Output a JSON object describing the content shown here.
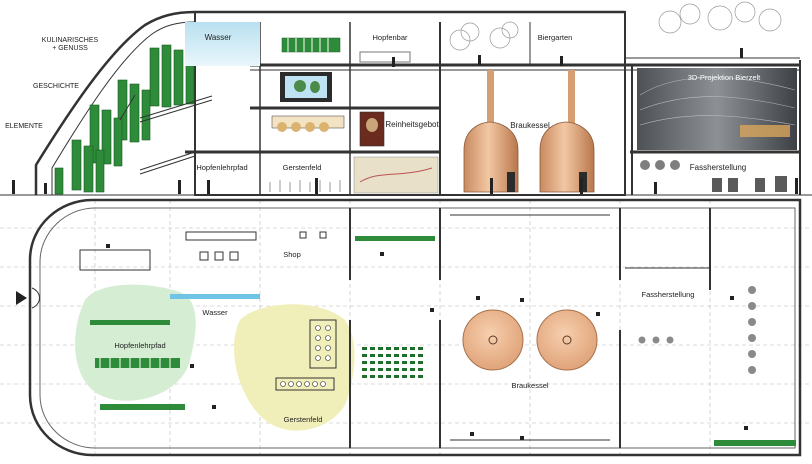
{
  "section": {
    "side_labels": {
      "culinary_line1": "KULINARISCHES",
      "culinary_line2": "+ GENUSS",
      "history": "GESCHICHTE",
      "elements": "ELEMENTE"
    },
    "rooms": {
      "water": "Wasser",
      "hop_bar": "Hopfenbar",
      "beer_garden": "Biergarten",
      "projection": "3D-Projektion Bierzelt",
      "purity_law": "Reinheitsgebot",
      "brew_kettle": "Braukessel",
      "hop_trail": "Hopfenlehrpfad",
      "barley_field": "Gerstenfeld",
      "barrel_making": "Fassherstellung"
    }
  },
  "plan": {
    "labels": {
      "shop": "Shop",
      "water": "Wasser",
      "hop_trail": "Hopfenlehrpfad",
      "barley_field": "Gerstenfeld",
      "brew_kettle": "Braukessel",
      "barrel_making": "Fassherstellung"
    }
  },
  "colors": {
    "hop_green": "#2e8b3a",
    "water_blue": "#cfe9f4",
    "copper": "#e9b48c",
    "hop_zone": "#d4edd3",
    "barley_zone": "#f1efb9",
    "projection_dark": "#5a5e63"
  }
}
